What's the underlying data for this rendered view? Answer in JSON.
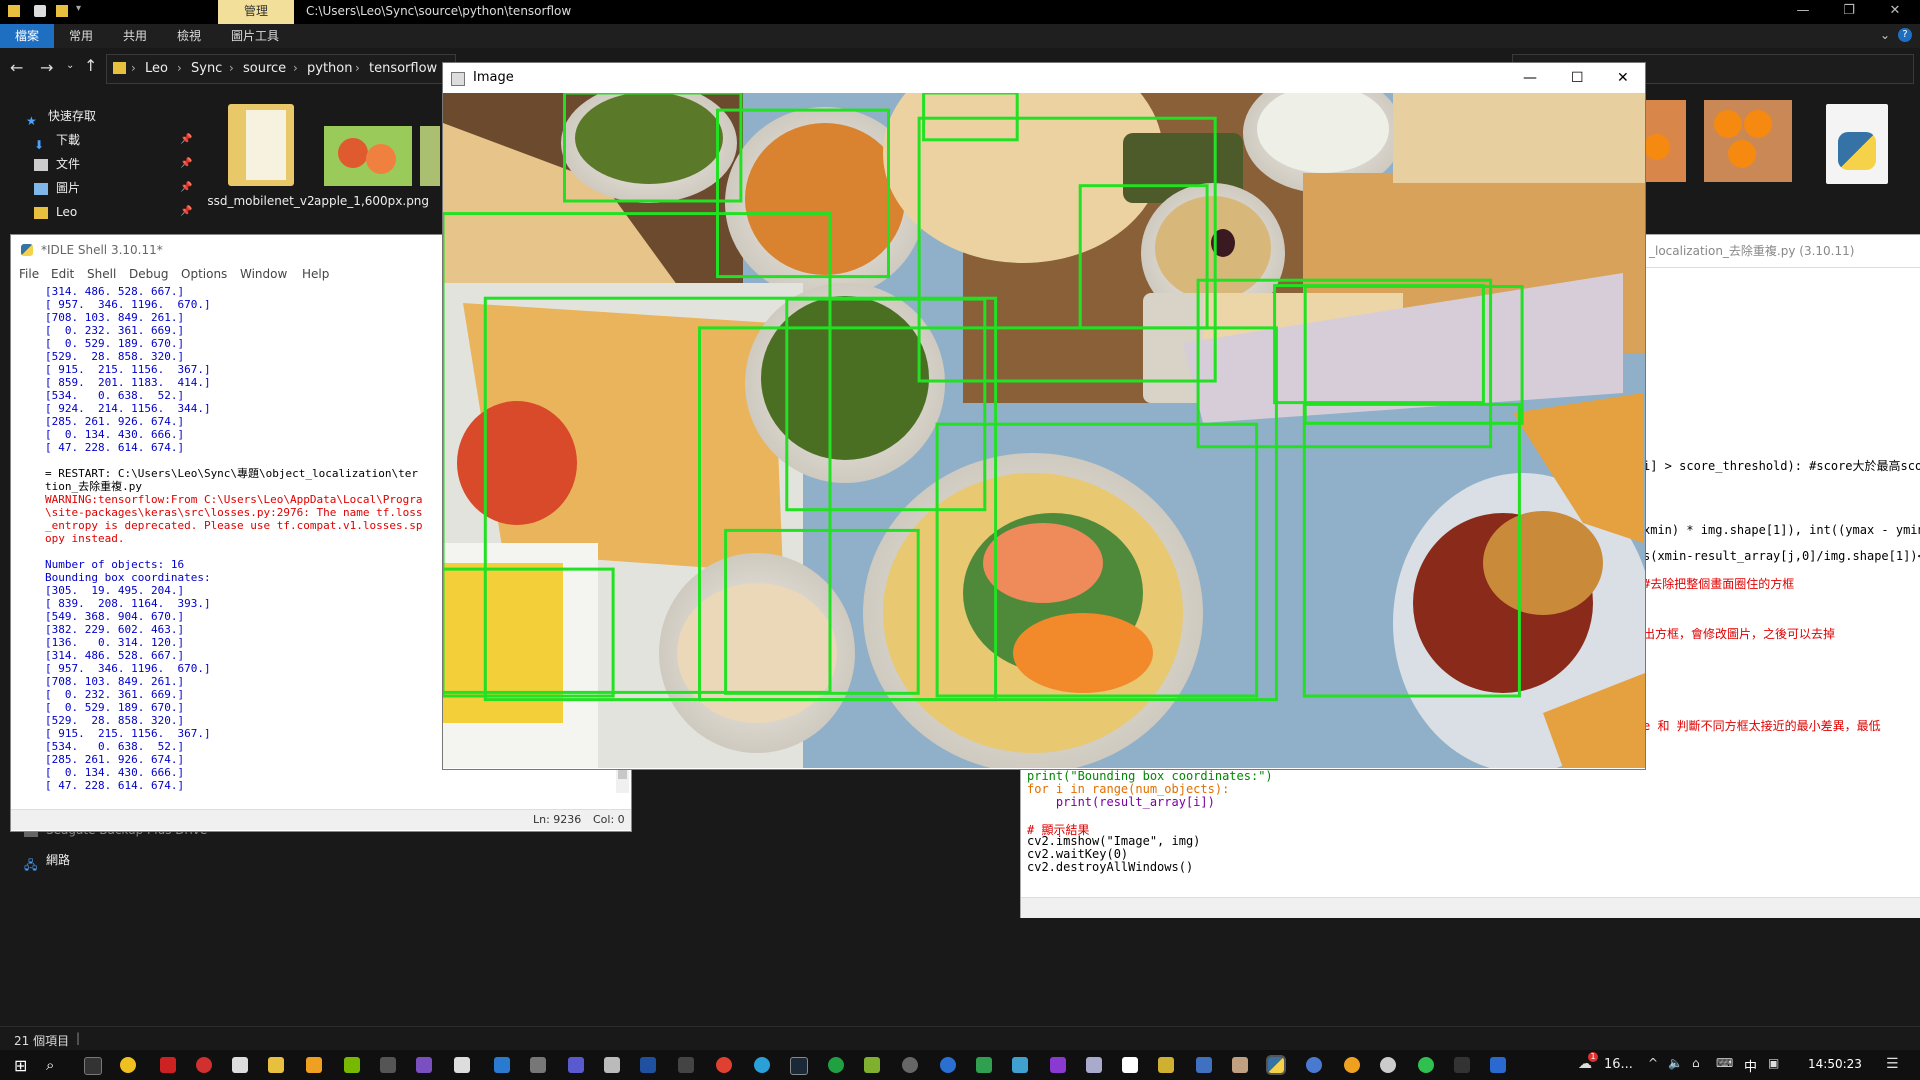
{
  "explorer": {
    "context_tab": "管理",
    "title_path": "C:\\Users\\Leo\\Sync\\source\\python\\tensorflow",
    "ribbon_tabs": [
      "檔案",
      "常用",
      "共用",
      "檢視",
      "圖片工具"
    ],
    "breadcrumb": [
      "Leo",
      "Sync",
      "source",
      "python",
      "tensorflow"
    ],
    "nav": [
      {
        "label": "快速存取",
        "pinned": false
      },
      {
        "label": "下載",
        "pinned": true
      },
      {
        "label": "文件",
        "pinned": true
      },
      {
        "label": "圖片",
        "pinned": true
      },
      {
        "label": "Leo",
        "pinned": true
      }
    ],
    "nav_bottom": [
      "Seagate Backup Plus Drive",
      "網路"
    ],
    "files": [
      {
        "name": "ssd_mobilenet_v2",
        "icon": "folder-icon"
      },
      {
        "name": "apple_1,600px.png",
        "icon": "image-thumbnail-icon"
      },
      {
        "name": "_localization_去除重複.py (3.10.11)",
        "icon": "python-file-icon"
      }
    ],
    "status_text": "21 個項目"
  },
  "idle": {
    "title": "*IDLE Shell 3.10.11*",
    "menu": [
      "File",
      "Edit",
      "Shell",
      "Debug",
      "Options",
      "Window",
      "Help"
    ],
    "lines_top": [
      "[314. 486. 528. 667.]",
      "[ 957.  346. 1196.  670.]",
      "[708. 103. 849. 261.]",
      "[  0. 232. 361. 669.]",
      "[  0. 529. 189. 670.]",
      "[529.  28. 858. 320.]",
      "[ 915.  215. 1156.  367.]",
      "[ 859.  201. 1183.  414.]",
      "[534.   0. 638.  52.]",
      "[ 924.  214. 1156.  344.]",
      "[285. 261. 926. 674.]",
      "[  0. 134. 430. 666.]",
      "[ 47. 228. 614. 674.]"
    ],
    "restart_line1": "= RESTART: C:\\Users\\Leo\\Sync\\專題\\object_localization\\ter",
    "restart_line2": "tion_去除重複.py",
    "warning_lines": [
      "WARNING:tensorflow:From C:\\Users\\Leo\\AppData\\Local\\Progra",
      "\\site-packages\\keras\\src\\losses.py:2976: The name tf.loss",
      "_entropy is deprecated. Please use tf.compat.v1.losses.sp",
      "opy instead."
    ],
    "num_objects": "Number of objects: 16",
    "bbox_header": "Bounding box coordinates:",
    "lines_bottom": [
      "[305.  19. 495. 204.]",
      "[ 839.  208. 1164.  393.]",
      "[549. 368. 904. 670.]",
      "[382. 229. 602. 463.]",
      "[136.   0. 314. 120.]",
      "[314. 486. 528. 667.]",
      "[ 957.  346. 1196.  670.]",
      "[708. 103. 849. 261.]",
      "[  0. 232. 361. 669.]",
      "[  0. 529. 189. 670.]",
      "[529.  28. 858. 320.]",
      "[ 915.  215. 1156.  367.]",
      "[534.   0. 638.  52.]",
      "[285. 261. 926. 674.]",
      "[  0. 134. 430. 666.]",
      "[ 47. 228. 614. 674.]"
    ],
    "status_ln": "Ln: 9236",
    "status_col": "Col: 0"
  },
  "editor": {
    "title": "_localization_去除重複.py (3.10.11)",
    "frag1": "i] > score_threshold): #score大於最高sco",
    "frag2": "xmin) * img.shape[1]), int((ymax - ymin",
    "frag3": "s(xmin-result_array[j,0]/img.shape[1])<",
    "frag4": "#去除把整個畫面圈住的方框",
    "frag5": "出方框，會修改圖片，之後可以去掉",
    "frag6": "e 和 判斷不同方框太接近的最小差異，最低",
    "code_lines": [
      "print(\"Bounding box coordinates:\")",
      "for i in range(num_objects):",
      "    print(result_array[i])",
      "",
      "# 顯示結果",
      "cv2.imshow(\"Image\", img)",
      "cv2.waitKey(0)",
      "cv2.destroyAllWindows()"
    ]
  },
  "image_window": {
    "title": "Image"
  },
  "taskbar": {
    "weather": "16...",
    "ime": "中",
    "time": "14:50:23",
    "notification_badge": "1"
  },
  "colors": {
    "box_green": "#22e022",
    "explorer_bg": "#191919",
    "context_tab": "#f2e09a",
    "file_tab": "#1e6fc2"
  }
}
